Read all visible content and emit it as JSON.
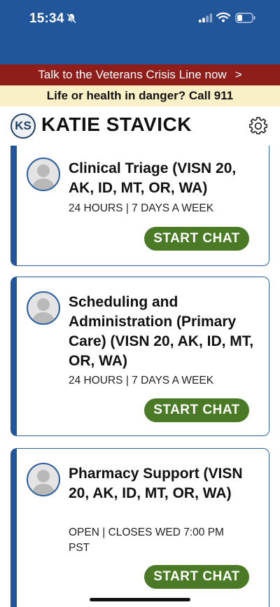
{
  "status_bar": {
    "time": "15:34",
    "icons": [
      "bell-slash-icon",
      "cellular-signal-icon",
      "wifi-icon",
      "battery-icon"
    ]
  },
  "crisis_banner": {
    "text": "Talk to the Veterans Crisis Line now",
    "chevron": ">"
  },
  "emergency_banner": {
    "text": "Life or health in danger? Call 911"
  },
  "header": {
    "initials": "KS",
    "name": "KATIE STAVICK",
    "settings_icon": "gear-icon"
  },
  "cards": [
    {
      "title": "Clinical Triage (VISN 20, AK, ID, MT, OR, WA)",
      "hours": "24 HOURS | 7 DAYS A WEEK",
      "button": "START CHAT"
    },
    {
      "title": "Scheduling and Administration (Primary Care) (VISN 20, AK, ID, MT, OR, WA)",
      "hours": "24 HOURS | 7 DAYS A WEEK",
      "button": "START CHAT"
    },
    {
      "title": "Pharmacy Support (VISN 20, AK, ID, MT, OR, WA)",
      "hours": "OPEN | CLOSES WED 7:00 PM PST",
      "button": "START CHAT"
    }
  ],
  "colors": {
    "header_blue": "#22569a",
    "crisis_red": "#8f1e1b",
    "emergency_yellow": "#faf0c8",
    "button_green": "#4a7a25"
  }
}
